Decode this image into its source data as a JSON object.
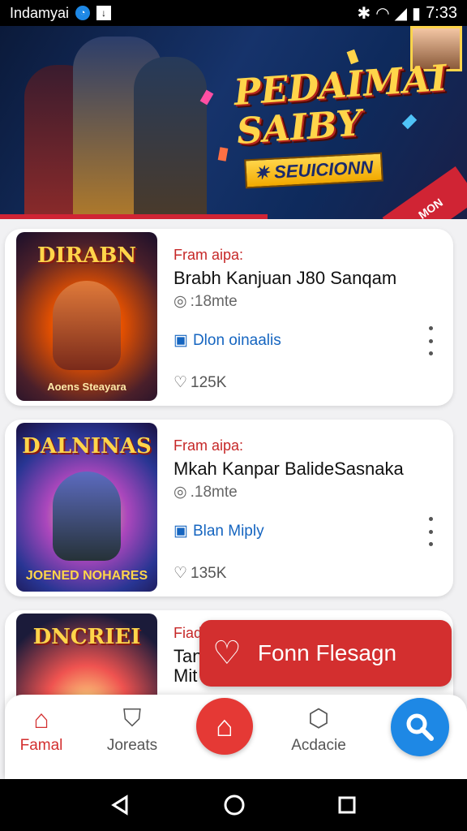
{
  "status_bar": {
    "app_name": "Indamyai",
    "time": "7:33"
  },
  "banner": {
    "title": "PEDAIMAI SAIBY",
    "subtitle": "SEUICIONN",
    "tag": "MON"
  },
  "cards": [
    {
      "category": "Fram aipa:",
      "title": "Brabh Kanjuan J80 Sanqam",
      "meta": ":18mte",
      "link": "Dlon oinaalis",
      "likes": "125K",
      "thumb_title": "DIRABN",
      "thumb_caption": "Aoens Steayara"
    },
    {
      "category": "Fram aipa:",
      "title": "Mkah Kanpar BalideSasnaka",
      "meta": ".18mte",
      "link": "Blan Miply",
      "likes": "135K",
      "thumb_title": "DALNINAS",
      "thumb_caption": "JOENED NOHARES"
    },
    {
      "category": "Fiad",
      "title": "Tan",
      "meta": "Mit",
      "thumb_title": "DNCRIEI"
    }
  ],
  "promo": {
    "label": "Fonn Flesagn"
  },
  "bottom_nav": {
    "items": [
      {
        "label": "Famal"
      },
      {
        "label": "Joreats"
      },
      {
        "label": "Acdacie"
      }
    ]
  },
  "colors": {
    "accent": "#d32f2f",
    "link": "#1565c0",
    "search": "#1e88e5"
  }
}
